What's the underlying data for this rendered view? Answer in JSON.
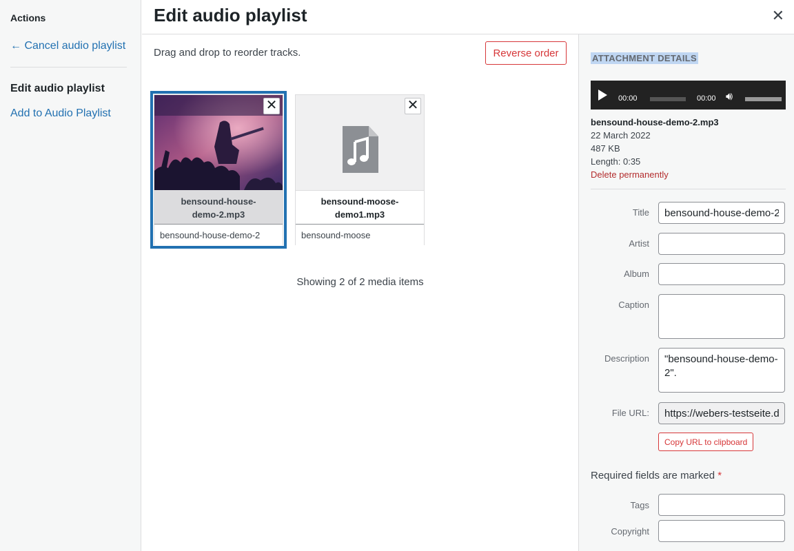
{
  "menu": {
    "actions_title": "Actions",
    "cancel_link": "← Cancel audio playlist",
    "active_item": "Edit audio playlist",
    "add_item": "Add to Audio Playlist"
  },
  "header": {
    "title": "Edit audio playlist",
    "close_icon": "close-icon"
  },
  "content": {
    "instructions": "Drag and drop to reorder tracks.",
    "reverse_button": "Reverse order",
    "attachments": [
      {
        "filename": "bensound-house-demo-2.mp3",
        "caption": "bensound-house-demo-2",
        "thumb": "concert-photo",
        "selected": true
      },
      {
        "filename": "bensound-moose-demo1.mp3",
        "caption": "bensound-moose",
        "thumb": "audio-file-icon",
        "selected": false
      }
    ],
    "remove_icon": "close-icon",
    "showing": "Showing 2 of 2 media items"
  },
  "sidebar": {
    "heading": "ATTACHMENT DETAILS",
    "player": {
      "current_time": "00:00",
      "duration": "00:00"
    },
    "file": {
      "name": "bensound-house-demo-2.mp3",
      "date": "22 March 2022",
      "size": "487 KB",
      "length": "Length: 0:35",
      "delete": "Delete permanently"
    },
    "fields": {
      "title_label": "Title",
      "title_value": "bensound-house-demo-2",
      "artist_label": "Artist",
      "artist_value": "",
      "album_label": "Album",
      "album_value": "",
      "caption_label": "Caption",
      "caption_value": "",
      "description_label": "Description",
      "description_value": "\"bensound-house-demo-2\".",
      "url_label": "File URL:",
      "url_value": "https://webers-testseite.de",
      "copy_button": "Copy URL to clipboard",
      "required_text": "Required fields are marked ",
      "required_star": "*",
      "tags_label": "Tags",
      "tags_value": "",
      "copyright_label": "Copyright",
      "copyright_value": ""
    }
  },
  "colors": {
    "accent": "#2271b1",
    "danger": "#d63638",
    "heading_highlight": "#bfd6f2"
  }
}
